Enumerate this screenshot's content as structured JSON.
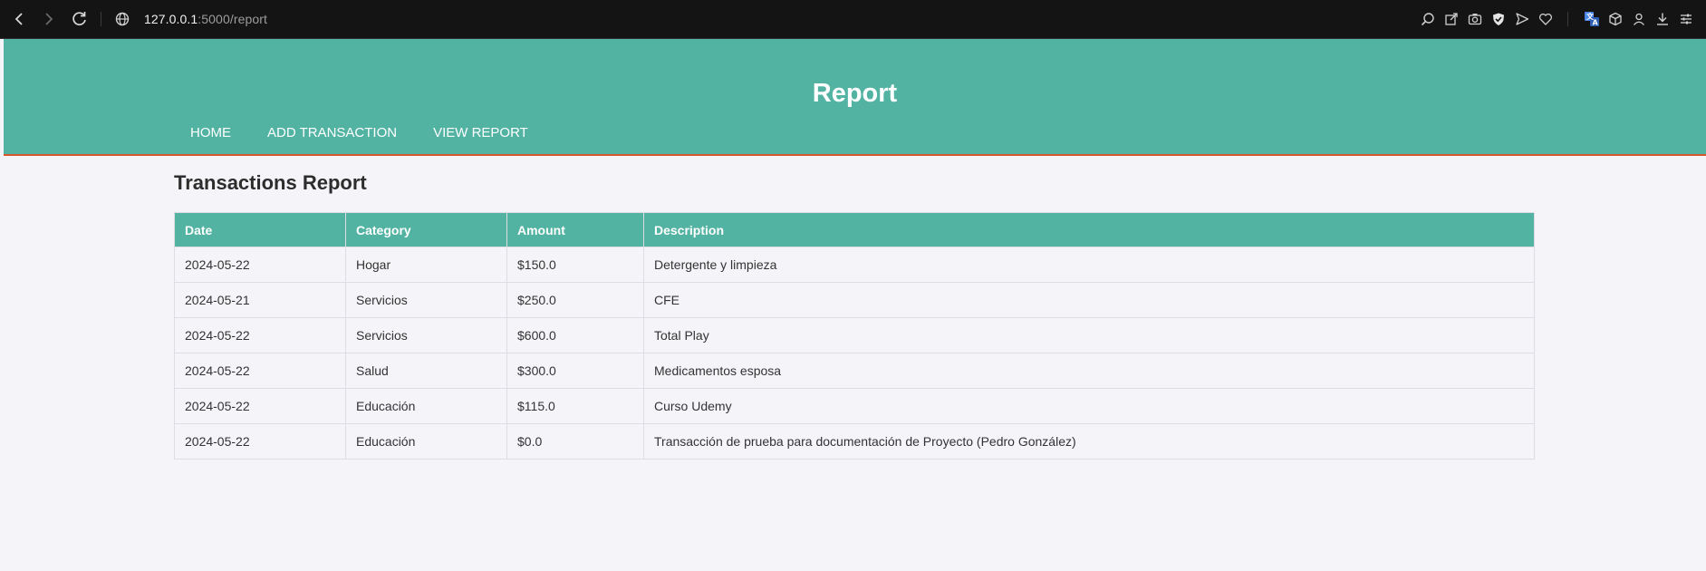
{
  "browser": {
    "url_host": "127.0.0.1",
    "url_path": ":5000/report"
  },
  "header": {
    "title": "Report",
    "nav": [
      "HOME",
      "ADD TRANSACTION",
      "VIEW REPORT"
    ]
  },
  "report": {
    "heading": "Transactions Report",
    "columns": [
      "Date",
      "Category",
      "Amount",
      "Description"
    ],
    "rows": [
      [
        "2024-05-22",
        "Hogar",
        "$150.0",
        "Detergente y limpieza"
      ],
      [
        "2024-05-21",
        "Servicios",
        "$250.0",
        "CFE"
      ],
      [
        "2024-05-22",
        "Servicios",
        "$600.0",
        "Total Play"
      ],
      [
        "2024-05-22",
        "Salud",
        "$300.0",
        "Medicamentos esposa"
      ],
      [
        "2024-05-22",
        "Educación",
        "$115.0",
        "Curso Udemy"
      ],
      [
        "2024-05-22",
        "Educación",
        "$0.0",
        "Transacción de prueba para documentación de Proyecto (Pedro González)"
      ]
    ]
  },
  "colors": {
    "accent": "#52b3a3",
    "header_border": "#d6572e",
    "page_bg": "#f5f4f8"
  }
}
